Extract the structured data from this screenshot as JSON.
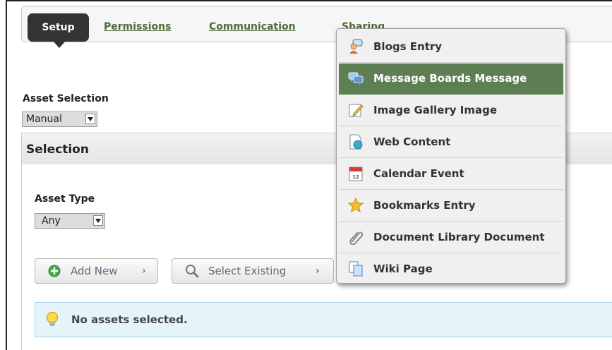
{
  "tabs": {
    "active": "Setup",
    "links": [
      "Permissions",
      "Communication",
      "Sharing"
    ]
  },
  "asset_selection": {
    "label": "Asset Selection",
    "value": "Manual"
  },
  "selection_panel": {
    "title": "Selection",
    "asset_type_label": "Asset Type",
    "asset_type_value": "Any",
    "add_new_label": "Add New",
    "select_existing_label": "Select Existing",
    "empty_message": "No assets selected."
  },
  "menu": {
    "items": [
      {
        "label": "Blogs Entry",
        "icon": "blogs-entry-icon"
      },
      {
        "label": "Message Boards Message",
        "icon": "message-boards-icon"
      },
      {
        "label": "Image Gallery Image",
        "icon": "image-gallery-icon"
      },
      {
        "label": "Web Content",
        "icon": "web-content-icon"
      },
      {
        "label": "Calendar Event",
        "icon": "calendar-icon"
      },
      {
        "label": "Bookmarks Entry",
        "icon": "star-icon"
      },
      {
        "label": "Document Library Document",
        "icon": "paperclip-icon"
      },
      {
        "label": "Wiki Page",
        "icon": "wiki-page-icon"
      }
    ],
    "highlighted_index": 1
  },
  "colors": {
    "link_green": "#4d6b3b",
    "menu_highlight": "#5e7f54",
    "info_bg": "#e5f4fb"
  }
}
